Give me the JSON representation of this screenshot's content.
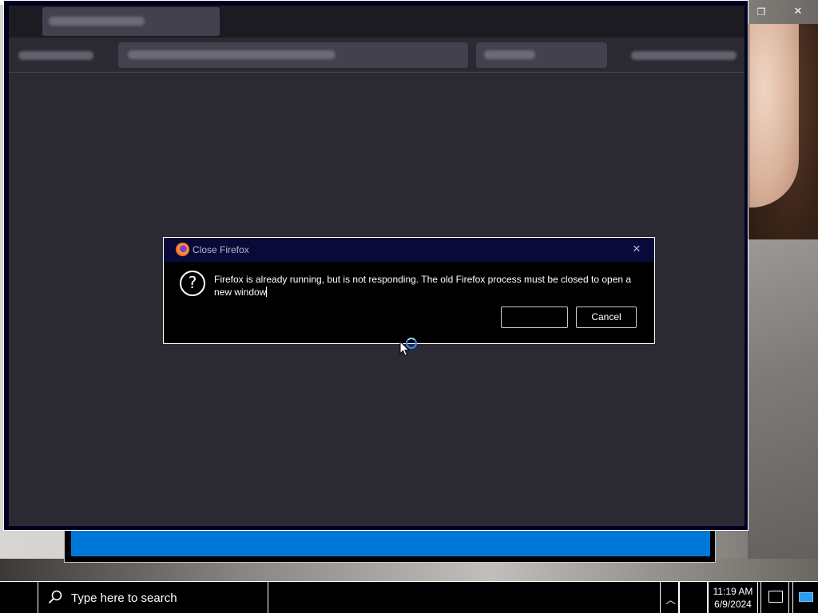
{
  "dialog": {
    "title": "Close Firefox",
    "message": "Firefox is already running, but is not responding. The old Firefox process must be closed to open a new window",
    "ok_label": "",
    "cancel_label": "Cancel"
  },
  "window_controls": {
    "restore_icon": "restore-icon",
    "close_icon": "close-icon"
  },
  "taskbar": {
    "search_placeholder": "Type here to search",
    "time": "11:19 AM",
    "date": "6/9/2024"
  },
  "colors": {
    "accent": "#0078d7",
    "busy_ring": "#2a8dff",
    "window_bg": "#2b2a33"
  }
}
